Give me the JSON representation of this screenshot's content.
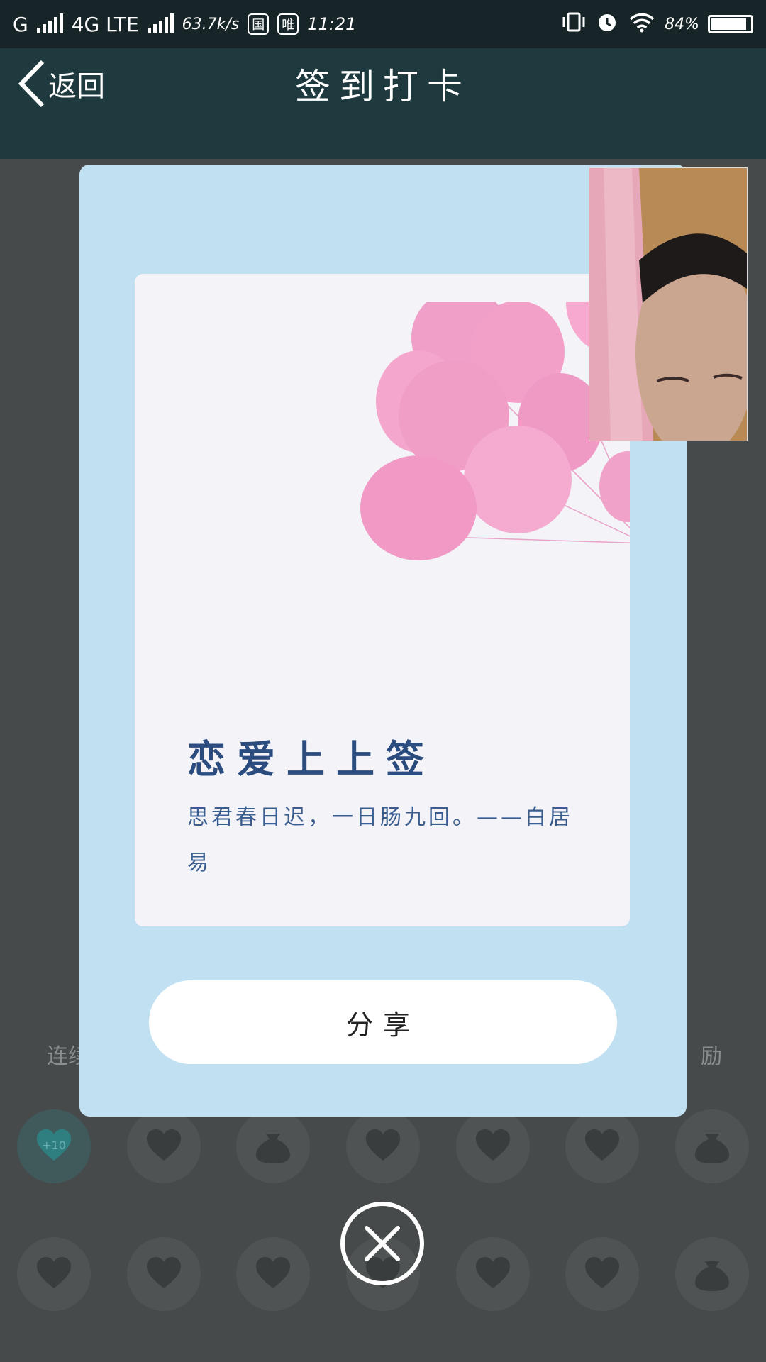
{
  "status_bar": {
    "carrier_1": "G",
    "carrier_2": "4G LTE",
    "net_speed": "63.7k/s",
    "badge_1": "国",
    "badge_2": "唯",
    "time": "11:21",
    "battery": "84%",
    "battery_level": 0.84
  },
  "header": {
    "back_label": "返回",
    "title": "签到打卡"
  },
  "modal": {
    "fortune_title": "恋爱上上签",
    "fortune_text": "思君春日迟，一日肠九回。——白居易",
    "share_label": "分享"
  },
  "background": {
    "streak_label": "连续",
    "reward_label": "励",
    "row1": [
      "+10",
      "heart",
      "bag",
      "heart",
      "heart",
      "heart",
      "bag"
    ],
    "row2": [
      "heart",
      "heart",
      "heart",
      "heart",
      "heart",
      "heart",
      "bag"
    ]
  },
  "colors": {
    "header_bg": "#1f3a3e",
    "modal_bg": "#c1e1f3",
    "inner_card_bg": "#f3f3f8",
    "title_color": "#2b4c7e",
    "balloon": "#f29ac6"
  }
}
